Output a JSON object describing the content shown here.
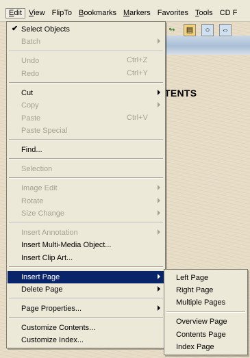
{
  "menubar": {
    "items": [
      {
        "label": "Edit",
        "accel": "E",
        "rest": "dit"
      },
      {
        "label": "View",
        "accel": "V",
        "rest": "iew"
      },
      {
        "label": "FlipTo",
        "accel": "",
        "rest": "FlipTo"
      },
      {
        "label": "Bookmarks",
        "accel": "B",
        "rest": "ookmarks"
      },
      {
        "label": "Markers",
        "accel": "M",
        "rest": "arkers"
      },
      {
        "label": "Favorites",
        "accel": "",
        "rest": "Favorites"
      },
      {
        "label": "Tools",
        "accel": "T",
        "rest": "ools"
      },
      {
        "label": "CD F",
        "accel": "",
        "rest": "CD F"
      }
    ]
  },
  "document": {
    "heading": "TENTS"
  },
  "toolbar": {
    "icons": [
      "link-icon",
      "book-icon",
      "disc-icon",
      "arrows-icon"
    ]
  },
  "edit_menu": {
    "select_objects": "Select Objects",
    "batch": "Batch",
    "undo": "Undo",
    "undo_shortcut": "Ctrl+Z",
    "redo": "Redo",
    "redo_shortcut": "Ctrl+Y",
    "cut": "Cut",
    "copy": "Copy",
    "paste": "Paste",
    "paste_shortcut": "Ctrl+V",
    "paste_special": "Paste Special",
    "find": "Find...",
    "selection": "Selection",
    "image_edit": "Image Edit",
    "rotate": "Rotate",
    "size_change": "Size Change",
    "insert_annotation": "Insert Annotation",
    "insert_multimedia": "Insert Multi-Media Object...",
    "insert_clip_art": "Insert Clip Art...",
    "insert_page": "Insert Page",
    "delete_page": "Delete Page",
    "page_properties": "Page Properties...",
    "customize_contents": "Customize Contents...",
    "customize_index": "Customize Index..."
  },
  "insert_page_submenu": {
    "left_page": "Left Page",
    "right_page": "Right Page",
    "multiple_pages": "Multiple Pages",
    "overview_page": "Overview Page",
    "contents_page": "Contents Page",
    "index_page": "Index Page"
  },
  "colors": {
    "menu_bg": "#ece9d8",
    "highlight": "#0a246a",
    "disabled_text": "#a4a293"
  }
}
